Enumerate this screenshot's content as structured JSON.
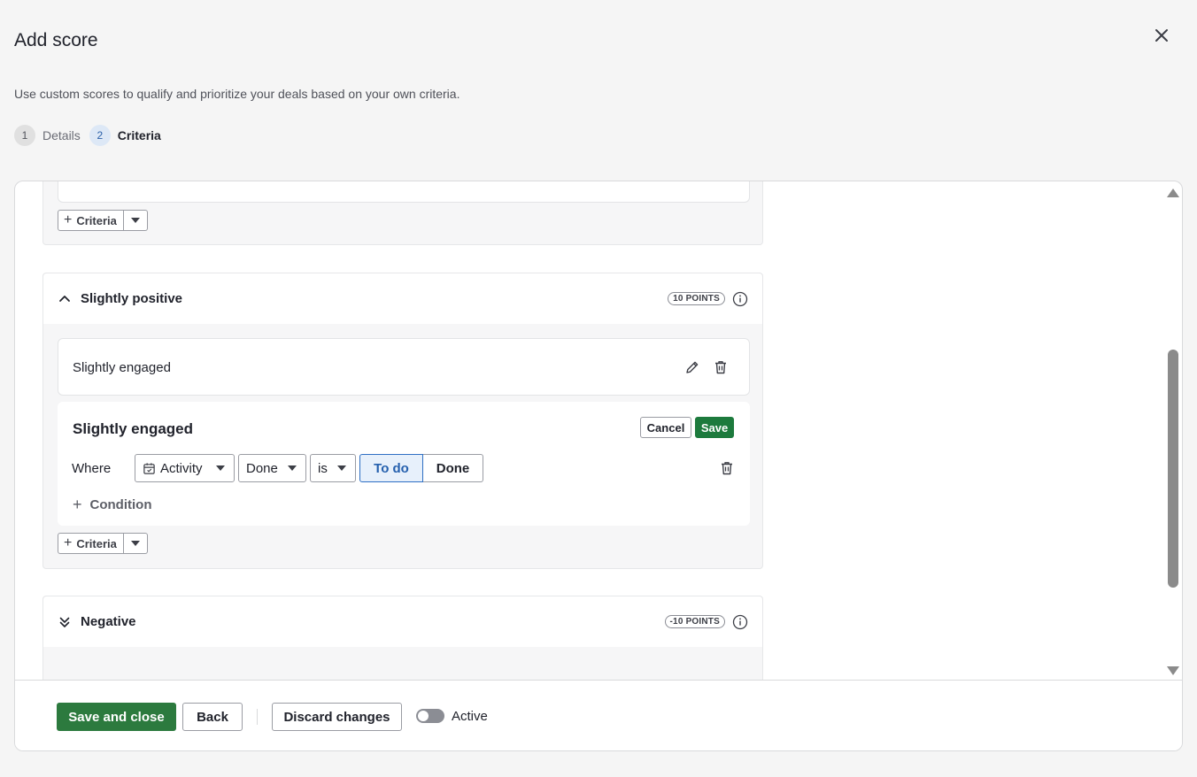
{
  "header": {
    "title": "Add score",
    "subtitle": "Use custom scores to qualify and prioritize your deals based on your own criteria."
  },
  "steps": [
    {
      "number": "1",
      "label": "Details",
      "state": "done"
    },
    {
      "number": "2",
      "label": "Criteria",
      "state": "current"
    }
  ],
  "top_group": {
    "criteria_label": "Criteria"
  },
  "slightly_positive": {
    "title": "Slightly positive",
    "points": "10 POINTS",
    "criterion": {
      "label": "Slightly engaged"
    },
    "editor": {
      "title": "Slightly engaged",
      "cancel_label": "Cancel",
      "save_label": "Save",
      "where_label": "Where",
      "field": "Activity",
      "property": "Done",
      "operator": "is",
      "options": [
        "To do",
        "Done"
      ],
      "selected_option": "To do",
      "add_condition_label": "Condition"
    },
    "criteria_label": "Criteria"
  },
  "negative": {
    "title": "Negative",
    "points": "-10 POINTS"
  },
  "footer": {
    "save_close_label": "Save and close",
    "back_label": "Back",
    "discard_label": "Discard changes",
    "active_label": "Active",
    "active_on": false
  },
  "colors": {
    "primary_green": "#2c7a3e",
    "selected_blue": "#2e6fc4",
    "scrollbar": "#8b8b8b"
  },
  "icons": [
    "close-icon",
    "chevron-up-icon",
    "double-chevron-down-icon",
    "info-icon",
    "pencil-icon",
    "trash-icon",
    "calendar-icon",
    "plus-icon",
    "caret-down-icon"
  ]
}
